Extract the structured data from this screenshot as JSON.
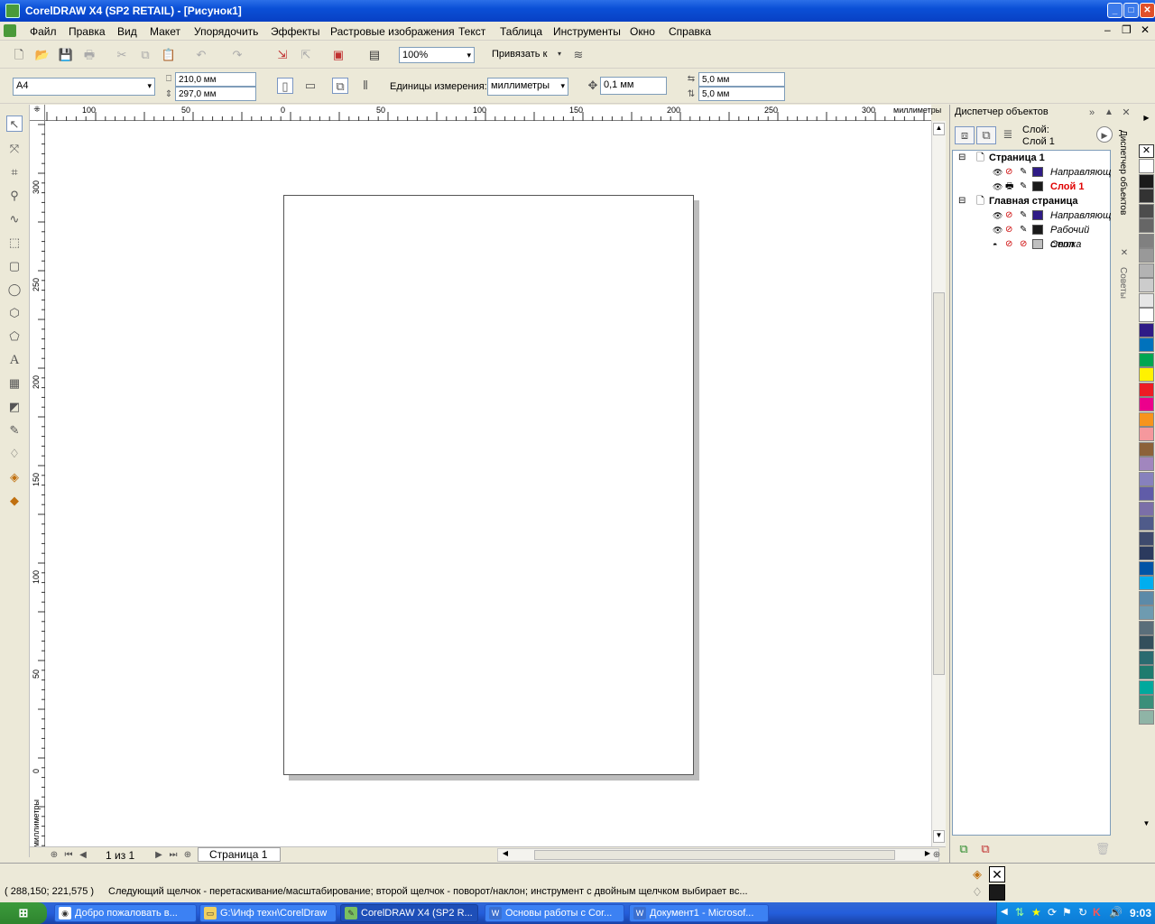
{
  "window": {
    "title": "CorelDRAW X4 (SP2 RETAIL) - [Рисунок1]"
  },
  "menu": [
    "Файл",
    "Правка",
    "Вид",
    "Макет",
    "Упорядочить",
    "Эффекты",
    "Растровые изображения",
    "Текст",
    "Таблица",
    "Инструменты",
    "Окно",
    "Справка"
  ],
  "toolbar": {
    "zoom": "100%",
    "snap_label": "Привязать к"
  },
  "property_bar": {
    "paper_size": "A4",
    "width": "210,0 мм",
    "height": "297,0 мм",
    "units_label": "Единицы измерения:",
    "units_value": "миллиметры",
    "nudge": "0,1 мм",
    "dup_x": "5,0 мм",
    "dup_y": "5,0 мм"
  },
  "rulers": {
    "top_labels": [
      "100",
      "50",
      "0",
      "50",
      "100",
      "150",
      "200",
      "250",
      "300"
    ],
    "top_unit": "миллиметры",
    "left_labels": [
      "300",
      "250",
      "200",
      "150",
      "100",
      "50",
      "0"
    ],
    "left_unit": "миллиметры"
  },
  "page_nav": {
    "counter": "1 из 1",
    "tab": "Страница 1"
  },
  "docker": {
    "title": "Диспетчер объектов",
    "layer_label": "Слой:",
    "layer_value": "Слой 1",
    "tree": [
      {
        "label": "Страница 1",
        "type": "page"
      },
      {
        "label": "Направляющ",
        "type": "layer",
        "color": "#2f1b86"
      },
      {
        "label": "Слой 1",
        "type": "layer-active",
        "color": "#1a1a1a"
      },
      {
        "label": "Главная страница",
        "type": "page"
      },
      {
        "label": "Направляющ",
        "type": "layer",
        "color": "#2f1b86"
      },
      {
        "label": "Рабочий стол",
        "type": "layer",
        "color": "#1a1a1a"
      },
      {
        "label": "Сетка",
        "type": "layer",
        "color": "#c0c0c0"
      }
    ],
    "side_tabs": [
      "Диспетчер объектов",
      "Советы"
    ]
  },
  "palette": [
    "#ffffff",
    "#1a1a1a",
    "#333333",
    "#4d4d4d",
    "#666666",
    "#808080",
    "#999999",
    "#b3b3b3",
    "#cccccc",
    "#e6e6e6",
    "#ffffff",
    "#2f1b86",
    "#0072bc",
    "#00a651",
    "#fff200",
    "#ed1c24",
    "#ec008c",
    "#f7941d",
    "#f5989d",
    "#8c6239",
    "#a186be",
    "#8781bd",
    "#605ca8",
    "#7b6fa8",
    "#4f5b8a",
    "#3e4a6d",
    "#2b3a5e",
    "#0054a6",
    "#00aeef",
    "#5c8aa8",
    "#6e9bb0",
    "#5a6e7a",
    "#334f5c",
    "#2a6b70",
    "#1e7b6e",
    "#00a99d",
    "#3a8f7a",
    "#8fb4a6"
  ],
  "status": {
    "coords": "( 288,150; 221,575 )",
    "hint": "Следующий щелчок - перетаскивание/масштабирование; второй щелчок - поворот/наклон; инструмент с двойным щелчком выбирает вс..."
  },
  "taskbar": {
    "items": [
      "Добро пожаловать в...",
      "G:\\Инф техн\\CorelDraw",
      "CorelDRAW X4 (SP2 R...",
      "Основы работы с Cor...",
      "Документ1 - Microsof..."
    ],
    "clock": "9:03"
  }
}
